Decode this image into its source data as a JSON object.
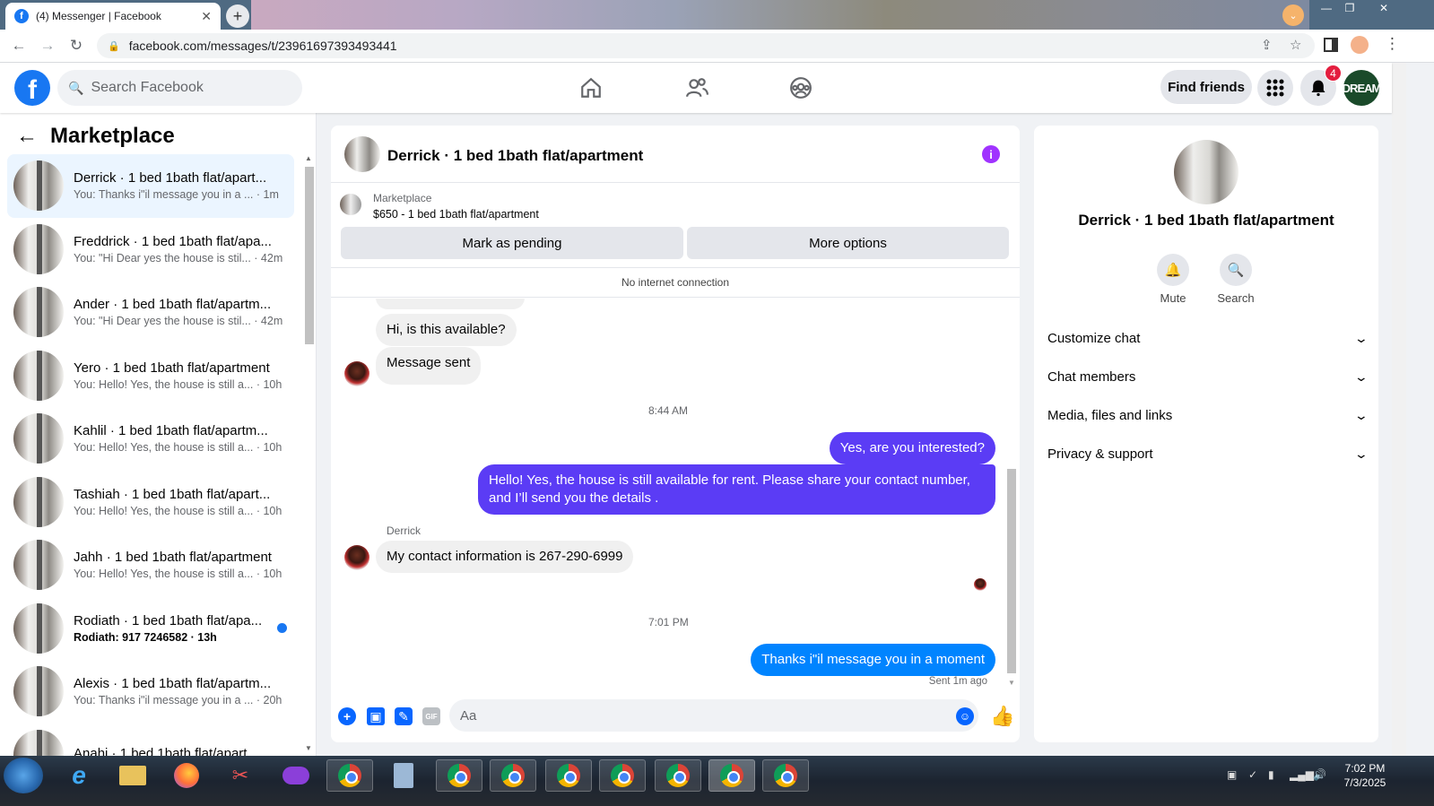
{
  "browser": {
    "tab_title": "(4) Messenger | Facebook",
    "new_tab": "+",
    "url": "facebook.com/messages/t/23961697393493441"
  },
  "header": {
    "search_placeholder": "Search Facebook",
    "find_friends": "Find friends",
    "notification_count": "4",
    "profile_initials": "DREAM"
  },
  "sidebar": {
    "title": "Marketplace",
    "conversations": [
      {
        "name": "Derrick · 1 bed 1bath flat/apart...",
        "snippet": "You: Thanks i\"il message you in a ...  · 1m",
        "active": true
      },
      {
        "name": "Freddrick · 1 bed 1bath flat/apa...",
        "snippet": "You: \"Hi Dear yes the house is stil...  · 42m"
      },
      {
        "name": "Ander · 1 bed 1bath flat/apartm...",
        "snippet": "You: \"Hi Dear yes the house is stil...  · 42m"
      },
      {
        "name": "Yero · 1 bed 1bath flat/apartment",
        "snippet": "You: Hello! Yes, the house is still a...  · 10h"
      },
      {
        "name": "Kahlil · 1 bed 1bath flat/apartm...",
        "snippet": "You: Hello! Yes, the house is still a...  · 10h"
      },
      {
        "name": "Tashiah · 1 bed 1bath flat/apart...",
        "snippet": "You: Hello! Yes, the house is still a...  · 10h"
      },
      {
        "name": "Jahh · 1 bed 1bath flat/apartment",
        "snippet": "You: Hello! Yes, the house is still a...  · 10h"
      },
      {
        "name": "Rodiath · 1 bed 1bath flat/apa...",
        "snippet": "Rodiath: 917 7246582 · 13h",
        "unread": true
      },
      {
        "name": "Alexis · 1 bed 1bath flat/apartm...",
        "snippet": "You: Thanks i\"il message you in a ...  · 20h"
      },
      {
        "name": "Anahi · 1 bed 1bath flat/apart...",
        "snippet": ""
      }
    ]
  },
  "chat": {
    "title": "Derrick · 1 bed 1bath flat/apartment",
    "listing_label": "Marketplace",
    "listing_price": "$650 - 1 bed 1bath flat/apartment",
    "mark_pending": "Mark as pending",
    "more_options": "More options",
    "no_internet": "No internet connection",
    "messages": {
      "m1": "Hi, is this available?",
      "m2": "Message sent",
      "time1": "8:44 AM",
      "m3": "Yes, are you interested?",
      "m4": "Hello! Yes, the house is still available for rent. Please share your contact number, and I’ll send you the details .",
      "sender": "Derrick",
      "m5": "My contact information is 267-290-6999",
      "time2": "7:01 PM",
      "m6": "Thanks i\"il message you in a moment",
      "sent_status": "Sent 1m ago"
    },
    "composer_placeholder": "Aa"
  },
  "right_panel": {
    "name": "Derrick · 1 bed 1bath flat/apartment",
    "mute": "Mute",
    "search": "Search",
    "rows": [
      "Customize chat",
      "Chat members",
      "Media, files and links",
      "Privacy & support"
    ]
  },
  "taskbar": {
    "time": "7:02 PM",
    "date": "7/3/2025"
  },
  "colors": {
    "fb_blue": "#1877f2",
    "outgoing_blue": "#0084ff",
    "outgoing_purple": "#5b3cf5",
    "info_purple": "#a033ff"
  }
}
